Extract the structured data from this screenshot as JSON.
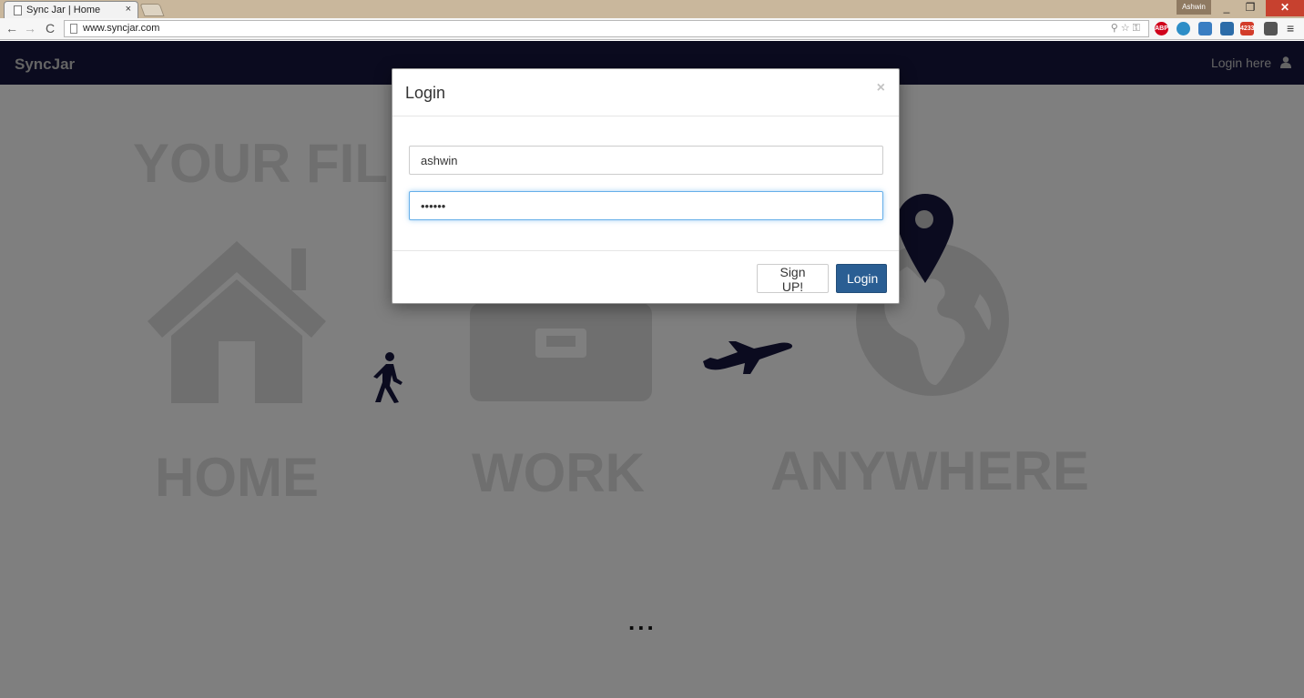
{
  "browser": {
    "tab_title": "Sync Jar | Home",
    "tab_close": "×",
    "profile_name": "Ashwin",
    "url": "www.syncjar.com",
    "mail_badge": "4233"
  },
  "navbar": {
    "brand": "SyncJar",
    "login_link": "Login here"
  },
  "hero": {
    "headline": "YOUR FIL",
    "labels": [
      "HOME",
      "WORK",
      "ANYWHERE"
    ]
  },
  "below": {
    "ellipsis": "..."
  },
  "modal": {
    "title": "Login",
    "close": "×",
    "username_value": "ashwin",
    "password_value": "••••••",
    "signup_label": "Sign UP!",
    "login_label": "Login"
  },
  "colors": {
    "navbar": "#16163f",
    "primary_button": "#2a5e93",
    "icon_dark": "#16163f"
  }
}
